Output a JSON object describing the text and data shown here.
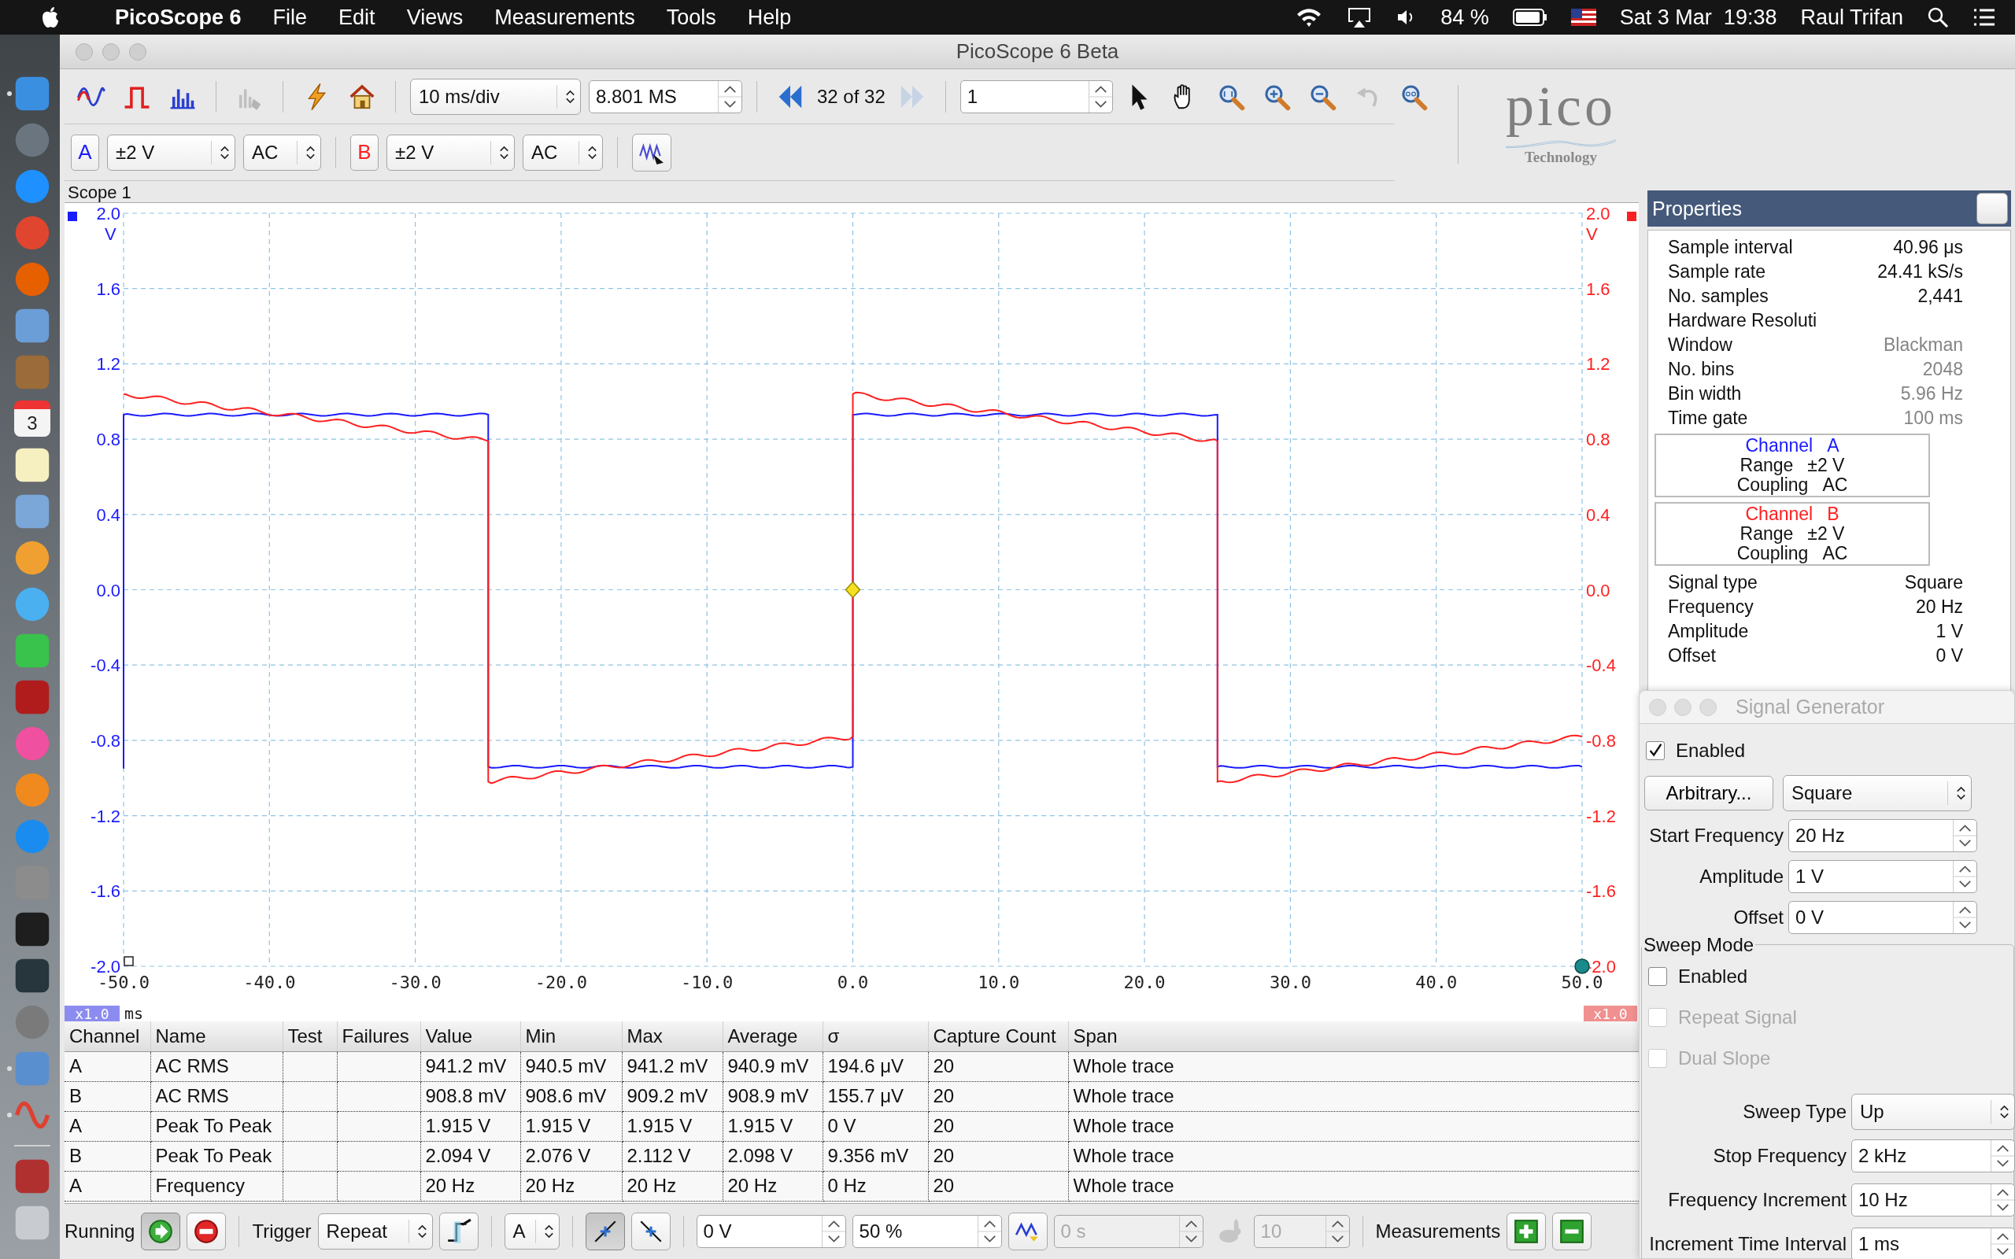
{
  "menubar": {
    "app": "PicoScope 6",
    "menus": [
      "File",
      "Edit",
      "Views",
      "Measurements",
      "Tools",
      "Help"
    ],
    "battery": "84 %",
    "clock": "Sat 3 Mar  19:38",
    "user": "Raul Trifan"
  },
  "dock": [
    {
      "kind": "square",
      "color": "#3b8fe0",
      "running": true
    },
    {
      "kind": "circle",
      "color": "#6b7580",
      "running": false
    },
    {
      "kind": "circle",
      "color": "#1e90ff",
      "running": false
    },
    {
      "kind": "circle",
      "color": "#e0452f",
      "running": false
    },
    {
      "kind": "circle",
      "color": "#e66000",
      "running": false
    },
    {
      "kind": "square",
      "color": "#6b9ed6",
      "running": false
    },
    {
      "kind": "square",
      "color": "#9b6b3a",
      "running": false
    },
    {
      "kind": "calendar",
      "color": "#f4f4f4",
      "label": "3",
      "running": false
    },
    {
      "kind": "square",
      "color": "#f6f0c0",
      "running": false
    },
    {
      "kind": "square",
      "color": "#7aa7d8",
      "running": false
    },
    {
      "kind": "circle",
      "color": "#f0a030",
      "running": false
    },
    {
      "kind": "circle",
      "color": "#4ab0f0",
      "running": false
    },
    {
      "kind": "square",
      "color": "#39c24c",
      "running": false
    },
    {
      "kind": "square",
      "color": "#b01c1c",
      "running": false
    },
    {
      "kind": "circle",
      "color": "#f050a0",
      "running": false
    },
    {
      "kind": "circle",
      "color": "#f08a1e",
      "running": false
    },
    {
      "kind": "circle",
      "color": "#1a8cf0",
      "running": false
    },
    {
      "kind": "square",
      "color": "#8c8c8c",
      "running": false
    },
    {
      "kind": "square",
      "color": "#1e1e1e",
      "running": false
    },
    {
      "kind": "square",
      "color": "#26363c",
      "running": false
    },
    {
      "kind": "circle",
      "color": "#7a7a7a",
      "running": false
    },
    {
      "kind": "square",
      "color": "#5a8fcf",
      "running": true
    },
    {
      "kind": "wave",
      "color": "#e04030",
      "running": true
    },
    {
      "kind": "separator"
    },
    {
      "kind": "square",
      "color": "#b03030",
      "running": false
    },
    {
      "kind": "square",
      "color": "#c8ccd0",
      "running": false
    }
  ],
  "window": {
    "title": "PicoScope 6 Beta"
  },
  "toolbar_top": [
    {
      "kind": "icon",
      "disabled": false
    },
    {
      "kind": "icon",
      "disabled": false
    },
    {
      "kind": "icon",
      "disabled": false
    },
    {
      "kind": "separator"
    },
    {
      "kind": "icon",
      "disabled": true
    },
    {
      "kind": "separator"
    },
    {
      "kind": "icon",
      "disabled": false
    },
    {
      "kind": "icon",
      "disabled": false
    },
    {
      "kind": "separator"
    },
    {
      "kind": "select",
      "value": "10 ms/div"
    },
    {
      "kind": "spin",
      "value": "8.801 MS",
      "disabled": false
    },
    {
      "kind": "separator"
    },
    {
      "kind": "icon",
      "disabled": false
    },
    {
      "kind": "text",
      "text": "32 of 32"
    },
    {
      "kind": "icon",
      "disabled": true
    },
    {
      "kind": "separator"
    },
    {
      "kind": "spin",
      "value": "1",
      "disabled": false
    },
    {
      "kind": "icon",
      "disabled": false
    },
    {
      "kind": "icon",
      "disabled": false
    },
    {
      "kind": "icon",
      "disabled": false
    },
    {
      "kind": "icon",
      "disabled": false
    },
    {
      "kind": "icon",
      "disabled": false
    },
    {
      "kind": "icon",
      "disabled": true
    },
    {
      "kind": "icon",
      "disabled": false
    }
  ],
  "toolbar_channels": [
    {
      "kind": "channel",
      "text": "A",
      "color": "#1a1aff"
    },
    {
      "kind": "select",
      "value": "±2 V"
    },
    {
      "kind": "select",
      "value": "AC"
    },
    {
      "kind": "separator"
    },
    {
      "kind": "channel",
      "text": "B",
      "color": "#ff2020"
    },
    {
      "kind": "select",
      "value": "±2 V"
    },
    {
      "kind": "select",
      "value": "AC"
    },
    {
      "kind": "separator"
    },
    {
      "kind": "button",
      "selected": false
    }
  ],
  "logo": {
    "word": "pico",
    "tagline": "Technology"
  },
  "scope": {
    "title": "Scope 1",
    "right_unit": "V",
    "right_labels": [
      "2.0",
      "1.6",
      "1.2",
      "0.8",
      "0.4",
      "0.0",
      "-0.4",
      "-0.8",
      "-1.2",
      "-1.6",
      "-2.0"
    ],
    "left_zoom": "x1.0",
    "right_zoom": "x1.0",
    "chart_data": {
      "type": "line",
      "grid": true,
      "xlabel": "ms",
      "ylabel": "V",
      "x": [
        -50,
        -50,
        -25,
        -25,
        0,
        0,
        25,
        25,
        50
      ],
      "series": [
        {
          "color": "#1a1aff",
          "values": [
            -0.95,
            0.93,
            0.93,
            -0.94,
            -0.94,
            0.93,
            0.93,
            -0.94,
            -0.94
          ]
        },
        {
          "color": "#ff2020",
          "values": [
            1.04,
            1.04,
            0.79,
            -1.02,
            -0.78,
            1.04,
            0.79,
            -1.02,
            -0.78
          ]
        }
      ],
      "xlim": [
        -50,
        50
      ],
      "ylim": [
        -2,
        2
      ],
      "xticks": [
        {
          "value": -50,
          "label": "-50.0"
        },
        {
          "value": -40,
          "label": "-40.0"
        },
        {
          "value": -30,
          "label": "-30.0"
        },
        {
          "value": -20,
          "label": "-20.0"
        },
        {
          "value": -10,
          "label": "-10.0"
        },
        {
          "value": 0,
          "label": "0.0"
        },
        {
          "value": 10,
          "label": "10.0"
        },
        {
          "value": 20,
          "label": "20.0"
        },
        {
          "value": 30,
          "label": "30.0"
        },
        {
          "value": 40,
          "label": "40.0"
        },
        {
          "value": 50,
          "label": "50.0"
        }
      ],
      "yticks": [
        {
          "value": 2,
          "label": "2.0"
        },
        {
          "value": 1.6,
          "label": "1.6"
        },
        {
          "value": 1.2,
          "label": "1.2"
        },
        {
          "value": 0.8,
          "label": "0.8"
        },
        {
          "value": 0.4,
          "label": "0.4"
        },
        {
          "value": 0,
          "label": "0.0"
        },
        {
          "value": -0.4,
          "label": "-0.4"
        },
        {
          "value": -0.8,
          "label": "-0.8"
        },
        {
          "value": -1.2,
          "label": "-1.2"
        },
        {
          "value": -1.6,
          "label": "-1.6"
        },
        {
          "value": -2,
          "label": "-2.0"
        }
      ]
    }
  },
  "measurements": {
    "columns": [
      "Channel",
      "Name",
      "Test",
      "Failures",
      "Value",
      "Min",
      "Max",
      "Average",
      "σ",
      "Capture Count",
      "Span"
    ],
    "rows": [
      [
        "A",
        "AC RMS",
        "",
        "",
        "941.2 mV",
        "940.5 mV",
        "941.2 mV",
        "940.9 mV",
        "194.6 μV",
        "20",
        "Whole trace"
      ],
      [
        "B",
        "AC RMS",
        "",
        "",
        "908.8 mV",
        "908.6 mV",
        "909.2 mV",
        "908.9 mV",
        "155.7 μV",
        "20",
        "Whole trace"
      ],
      [
        "A",
        "Peak To Peak",
        "",
        "",
        "1.915 V",
        "1.915 V",
        "1.915 V",
        "1.915 V",
        "0 V",
        "20",
        "Whole trace"
      ],
      [
        "B",
        "Peak To Peak",
        "",
        "",
        "2.094 V",
        "2.076 V",
        "2.112 V",
        "2.098 V",
        "9.356 mV",
        "20",
        "Whole trace"
      ],
      [
        "A",
        "Frequency",
        "",
        "",
        "20 Hz",
        "20 Hz",
        "20 Hz",
        "20 Hz",
        "0 Hz",
        "20",
        "Whole trace"
      ]
    ]
  },
  "bottom_bar": [
    {
      "kind": "text",
      "text": "Running"
    },
    {
      "kind": "button",
      "selected": true
    },
    {
      "kind": "button",
      "selected": false
    },
    {
      "kind": "separator"
    },
    {
      "kind": "text",
      "text": "Trigger"
    },
    {
      "kind": "select",
      "value": "Repeat"
    },
    {
      "kind": "button",
      "selected": false
    },
    {
      "kind": "separator"
    },
    {
      "kind": "select",
      "value": "A"
    },
    {
      "kind": "separator"
    },
    {
      "kind": "button",
      "selected": true
    },
    {
      "kind": "button",
      "selected": false
    },
    {
      "kind": "separator"
    },
    {
      "kind": "spin",
      "value": "0 V",
      "disabled": false
    },
    {
      "kind": "spin",
      "value": "50 %",
      "disabled": false
    },
    {
      "kind": "button",
      "selected": false
    },
    {
      "kind": "spin",
      "value": "0 s",
      "disabled": true
    },
    {
      "kind": "icon",
      "disabled": true
    },
    {
      "kind": "spin",
      "value": "10",
      "disabled": true
    },
    {
      "kind": "separator"
    },
    {
      "kind": "text",
      "text": "Measurements"
    },
    {
      "kind": "button",
      "selected": false
    },
    {
      "kind": "button",
      "selected": false
    }
  ],
  "properties": {
    "title": "Properties",
    "rows": [
      {
        "label": "Sample interval",
        "value": "40.96 μs",
        "dimmed": false
      },
      {
        "label": "Sample rate",
        "value": "24.41 kS/s",
        "dimmed": false
      },
      {
        "label": "No. samples",
        "value": "2,441",
        "dimmed": false
      },
      {
        "label": "Hardware Resoluti"
      },
      {
        "label": "Window",
        "value": "Blackman",
        "dimmed": true
      },
      {
        "label": "No. bins",
        "value": "2048",
        "dimmed": true
      },
      {
        "label": "Bin width",
        "value": "5.96 Hz",
        "dimmed": true
      },
      {
        "label": "Time gate",
        "value": "100 ms",
        "dimmed": true
      }
    ],
    "channels": [
      {
        "label": "Channel",
        "name": "A",
        "color": "#1a1aff",
        "range_label": "Range",
        "range": "±2 V",
        "coupling_label": "Coupling",
        "coupling": "AC"
      },
      {
        "label": "Channel",
        "name": "B",
        "color": "#ff2020",
        "range_label": "Range",
        "range": "±2 V",
        "coupling_label": "Coupling",
        "coupling": "AC"
      }
    ],
    "signal_rows": [
      {
        "label": "Signal type",
        "value": "Square",
        "dimmed": false
      },
      {
        "label": "Frequency",
        "value": "20 Hz",
        "dimmed": false
      },
      {
        "label": "Amplitude",
        "value": "1 V",
        "dimmed": false
      },
      {
        "label": "Offset",
        "value": "0 V",
        "dimmed": false
      }
    ]
  },
  "signal_generator": {
    "title": "Signal Generator",
    "enabled": {
      "label": "Enabled",
      "checked": true
    },
    "arbitrary_button": "Arbitrary...",
    "waveform": "Square",
    "fields": [
      {
        "label": "Start Frequency",
        "value": "20 Hz"
      },
      {
        "label": "Amplitude",
        "value": "1 V"
      },
      {
        "label": "Offset",
        "value": "0 V"
      }
    ],
    "sweep": {
      "title": "Sweep Mode",
      "options": [
        {
          "label": "Enabled",
          "checked": false,
          "disabled": false
        },
        {
          "label": "Repeat Signal",
          "checked": false,
          "disabled": true
        },
        {
          "label": "Dual Slope",
          "checked": false,
          "disabled": true
        }
      ],
      "fields": [
        {
          "kind": "select",
          "label": "Sweep Type",
          "value": "Up"
        },
        {
          "kind": "spin",
          "label": "Stop Frequency",
          "value": "2 kHz"
        },
        {
          "kind": "spin",
          "label": "Frequency Increment",
          "value": "10 Hz"
        },
        {
          "kind": "spin",
          "label": "Increment Time Interval",
          "value": "1 ms"
        }
      ]
    }
  }
}
